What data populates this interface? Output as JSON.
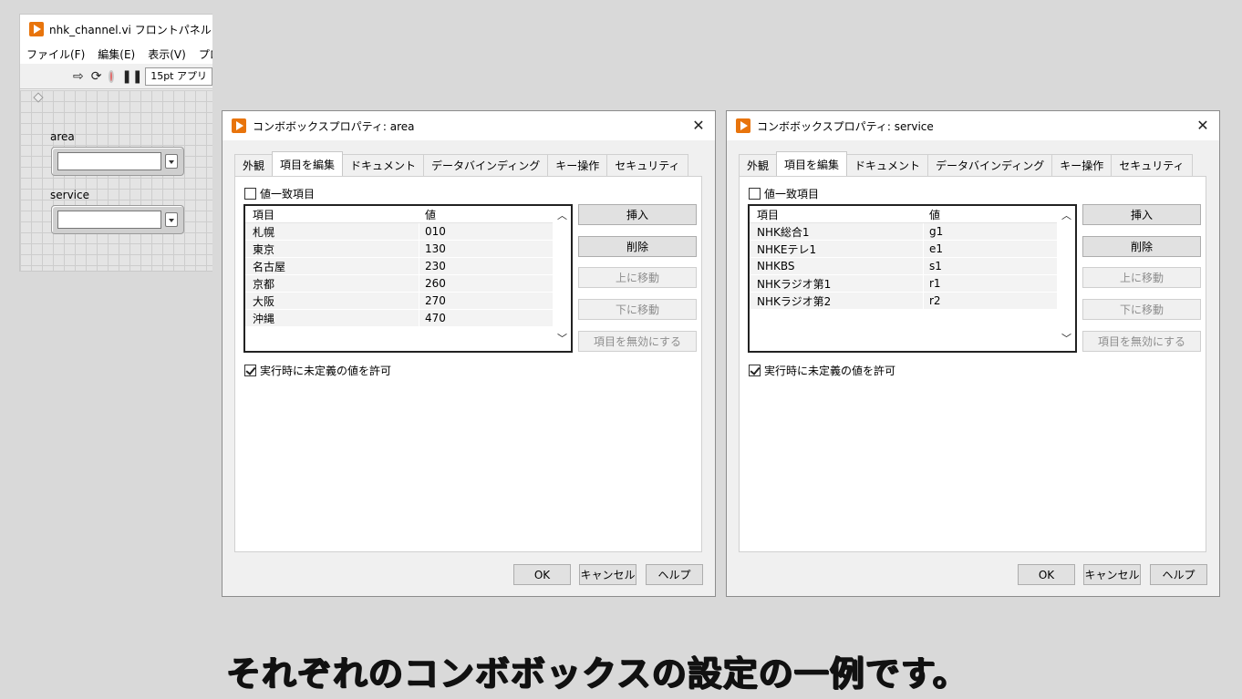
{
  "front_panel": {
    "title": "nhk_channel.vi フロントパネル",
    "menu": [
      "ファイル(F)",
      "編集(E)",
      "表示(V)",
      "プロジ"
    ],
    "font_selector": "15pt アプリ",
    "controls": [
      {
        "label": "area"
      },
      {
        "label": "service"
      }
    ]
  },
  "dialogs": [
    {
      "title": "コンボボックスプロパティ: area",
      "tabs": [
        "外観",
        "項目を編集",
        "ドキュメント",
        "データバインディング",
        "キー操作",
        "セキュリティ"
      ],
      "active_tab": "項目を編集",
      "value_match_label": "値一致項目",
      "value_match_checked": false,
      "columns": [
        "項目",
        "値"
      ],
      "rows": [
        [
          "札幌",
          "010"
        ],
        [
          "東京",
          "130"
        ],
        [
          "名古屋",
          "230"
        ],
        [
          "京都",
          "260"
        ],
        [
          "大阪",
          "270"
        ],
        [
          "沖縄",
          "470"
        ]
      ],
      "buttons": [
        "挿入",
        "削除",
        "上に移動",
        "下に移動",
        "項目を無効にする"
      ],
      "allow_undefined_label": "実行時に未定義の値を許可",
      "allow_undefined_checked": true,
      "footer": [
        "OK",
        "キャンセル",
        "ヘルプ"
      ]
    },
    {
      "title": "コンボボックスプロパティ: service",
      "tabs": [
        "外観",
        "項目を編集",
        "ドキュメント",
        "データバインディング",
        "キー操作",
        "セキュリティ"
      ],
      "active_tab": "項目を編集",
      "value_match_label": "値一致項目",
      "value_match_checked": false,
      "columns": [
        "項目",
        "値"
      ],
      "rows": [
        [
          "NHK総合1",
          "g1"
        ],
        [
          "NHKEテレ1",
          "e1"
        ],
        [
          "NHKBS",
          "s1"
        ],
        [
          "NHKラジオ第1",
          "r1"
        ],
        [
          "NHKラジオ第2",
          "r2"
        ]
      ],
      "buttons": [
        "挿入",
        "削除",
        "上に移動",
        "下に移動",
        "項目を無効にする"
      ],
      "allow_undefined_label": "実行時に未定義の値を許可",
      "allow_undefined_checked": true,
      "footer": [
        "OK",
        "キャンセル",
        "ヘルプ"
      ]
    }
  ],
  "caption": "それぞれのコンボボックスの設定の一例です。",
  "colors": {
    "labview_orange": "#e8740c",
    "background": "#d9d9d9"
  },
  "icons": [
    "labview-icon",
    "run-arrow-icon",
    "run-continuously-icon",
    "abort-icon",
    "pause-icon",
    "close-icon",
    "scroll-up-icon",
    "scroll-down-icon",
    "dropdown-arrow-icon"
  ]
}
